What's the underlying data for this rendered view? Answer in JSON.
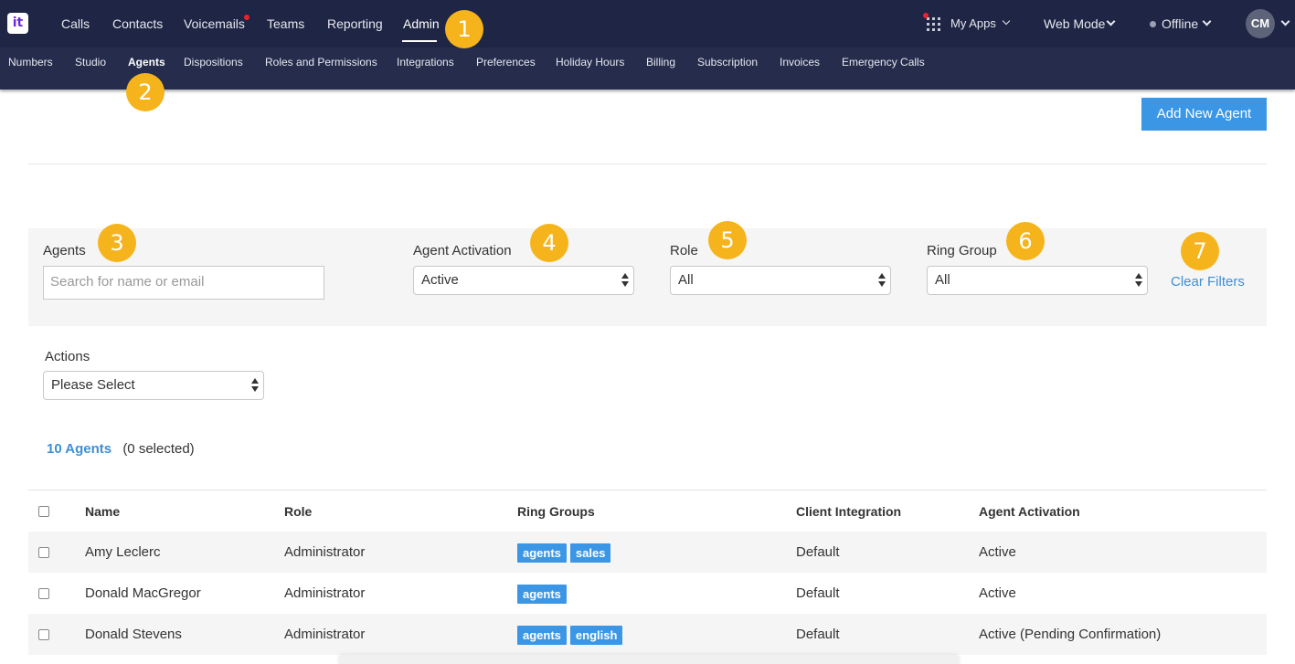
{
  "logo_text": "it",
  "topnav": {
    "items": [
      {
        "label": "Calls"
      },
      {
        "label": "Contacts"
      },
      {
        "label": "Voicemails"
      },
      {
        "label": "Teams"
      },
      {
        "label": "Reporting"
      },
      {
        "label": "Admin",
        "active": true
      }
    ],
    "right": {
      "my_apps": "My Apps",
      "web_mode": "Web Mode",
      "status": "Offline",
      "avatar_initials": "CM"
    }
  },
  "subnav": {
    "items": [
      "Numbers",
      "Studio",
      "Agents",
      "Dispositions",
      "Roles and Permissions",
      "Integrations",
      "Preferences",
      "Holiday Hours",
      "Billing",
      "Subscription",
      "Invoices",
      "Emergency Calls"
    ],
    "active": "Agents"
  },
  "badges": [
    "1",
    "2",
    "3",
    "4",
    "5",
    "6",
    "7"
  ],
  "add_button": "Add New Agent",
  "filters": {
    "agents_label": "Agents",
    "agents_placeholder": "Search for name or email",
    "activation_label": "Agent Activation",
    "activation_value": "Active",
    "role_label": "Role",
    "role_value": "All",
    "ring_group_label": "Ring Group",
    "ring_group_value": "All",
    "clear_filters": "Clear Filters"
  },
  "actions": {
    "label": "Actions",
    "value": "Please Select"
  },
  "summary": {
    "count": "10 Agents",
    "selected": "(0 selected)"
  },
  "table": {
    "headers": [
      "Name",
      "Role",
      "Ring Groups",
      "Client Integration",
      "Agent Activation"
    ],
    "rows": [
      {
        "name": "Amy Leclerc",
        "role": "Administrator",
        "groups": [
          "agents",
          "sales"
        ],
        "integration": "Default",
        "activation": "Active"
      },
      {
        "name": "Donald MacGregor",
        "role": "Administrator",
        "groups": [
          "agents"
        ],
        "integration": "Default",
        "activation": "Active"
      },
      {
        "name": "Donald Stevens",
        "role": "Administrator",
        "groups": [
          "agents",
          "english"
        ],
        "integration": "Default",
        "activation": "Active (Pending Confirmation)"
      }
    ]
  },
  "colors": {
    "nav_bg": "#1f2544",
    "subnav_bg": "#252c4c",
    "accent": "#3b97e5",
    "badge": "#f5b41b",
    "notification": "#e8232b"
  }
}
